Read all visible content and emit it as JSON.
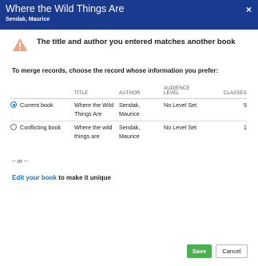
{
  "dialog": {
    "title": "Where the Wild Things Are",
    "subtitle": "Sendak, Maurice",
    "warning": "The title and author you entered matches another book",
    "instructions": "To merge records, choose the record whose information you prefer:",
    "columns": {
      "title": "TITLE",
      "author": "AUTHOR",
      "audience_line1": "AUDIENCE",
      "audience_line2": "LEVEL",
      "classes": "CLASSES"
    },
    "records": [
      {
        "label": "Current book",
        "selected": true,
        "title_l1": "Where the Wild",
        "title_l2": "Things Are",
        "author_l1": "Sendak,",
        "author_l2": "Maurice",
        "level": "No Level Set",
        "classes": "5"
      },
      {
        "label": "Conflicting book",
        "selected": false,
        "title_l1": "Where the wild",
        "title_l2": "things are",
        "author_l1": "Sendak,",
        "author_l2": "Maurice",
        "level": "No Level Set",
        "classes": "1"
      }
    ],
    "or_text": "-- or --",
    "edit_link": "Edit your book",
    "edit_suffix": " to make it unique",
    "save_label": "Save",
    "cancel_label": "Cancel",
    "close_symbol": "×"
  },
  "colors": {
    "header": "#1a3a8f",
    "accent": "#1a73c9",
    "save": "#4caf50",
    "warning": "#f0a383"
  },
  "icons": {
    "close": "close-icon",
    "warning": "warning-icon"
  }
}
